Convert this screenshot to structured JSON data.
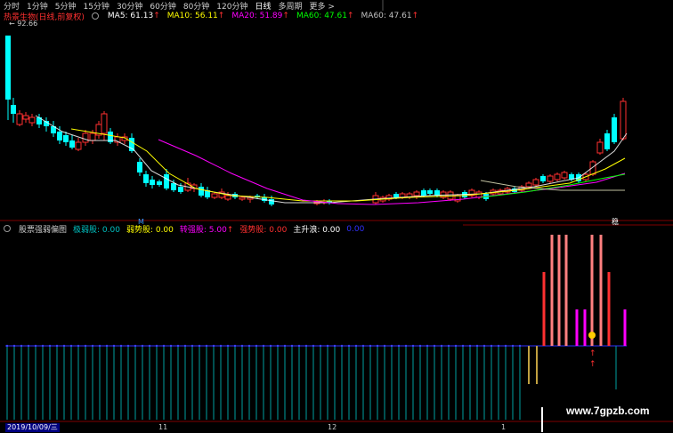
{
  "toolbar": {
    "items": [
      "分时",
      "1分钟",
      "5分钟",
      "15分钟",
      "30分钟",
      "60分钟",
      "80分钟",
      "120分钟",
      "日线",
      "多周期",
      "更多 >"
    ],
    "active_index": 8
  },
  "stock": {
    "name": "热景生物(日线,前复权)",
    "ma": [
      {
        "label": "MA5: 61.13",
        "arrow": "↑",
        "color": "#ffffff"
      },
      {
        "label": "MA10: 56.11",
        "arrow": "↑",
        "color": "#ffff00"
      },
      {
        "label": "MA20: 51.89",
        "arrow": "↑",
        "color": "#ff00ff"
      },
      {
        "label": "MA60: 47.61",
        "arrow": "↑",
        "color": "#00ff00"
      },
      {
        "label": "MA60: 47.61",
        "arrow": "↑",
        "color": "#c0c0c0"
      }
    ],
    "peak_price": "92.66"
  },
  "indicator": {
    "title": "股票强弱偏图",
    "items": [
      {
        "label": "极弱股: 0.00",
        "color": "#00c0c0"
      },
      {
        "label": "弱势股: 0.00",
        "color": "#ffff00"
      },
      {
        "label": "转强股: 5.00",
        "arrow": "↑",
        "color": "#ff00ff"
      },
      {
        "label": "强势股: 0.00",
        "color": "#ff3030"
      },
      {
        "label": "主升浪: 0.00",
        "color": "#ffffff"
      },
      {
        "label": "0.00",
        "color": "#3030ff"
      }
    ]
  },
  "axis": {
    "date_label": "2019/10/09/三",
    "ticks": [
      "11",
      "12",
      "1"
    ],
    "markers": [
      "M",
      "稳"
    ]
  },
  "watermark": "www.7gpzb.com",
  "colors": {
    "up": "#ff3030",
    "down": "#00ffff",
    "ma5": "#ffffff",
    "ma10": "#ffff00",
    "ma20": "#ff00ff",
    "ma60": "#00ff00"
  }
}
